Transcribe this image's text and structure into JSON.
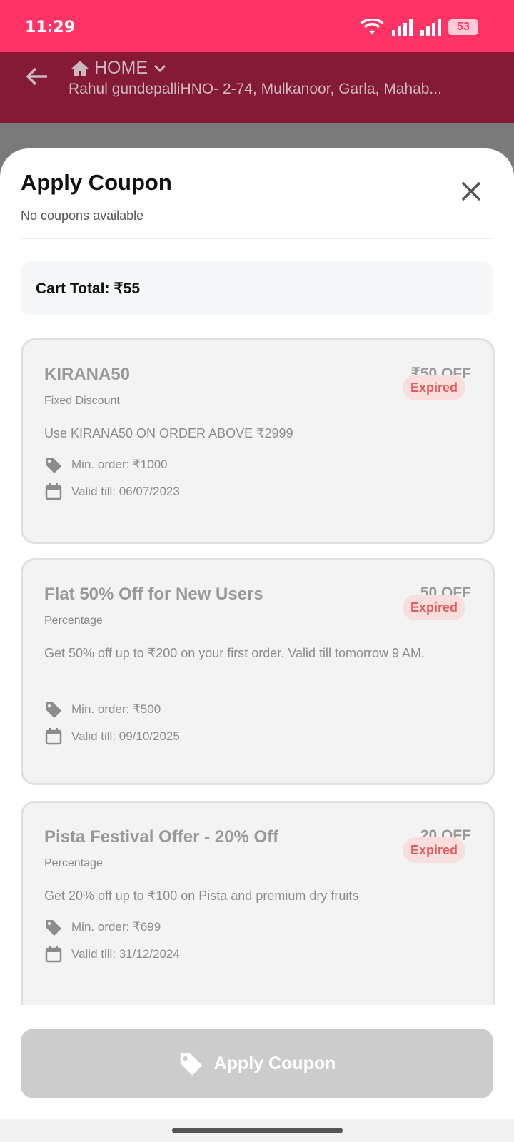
{
  "status": {
    "time": "11:29",
    "battery": "53"
  },
  "header": {
    "location_label": "HOME",
    "address": "Rahul gundepalliHNO- 2-74, Mulkanoor, Garla, Mahab..."
  },
  "sheet": {
    "title": "Apply Coupon",
    "subtitle": "No coupons available",
    "cart_total": "Cart Total: ₹55"
  },
  "coupons": [
    {
      "title": "KIRANA50",
      "type": "Fixed Discount",
      "off": "₹50 OFF",
      "status": "Expired",
      "desc": "Use KIRANA50 ON ORDER ABOVE ₹2999",
      "min_order": "Min. order: ₹1000",
      "valid": "Valid till: 06/07/2023"
    },
    {
      "title": "Flat 50% Off for New Users",
      "type": "Percentage",
      "off": "50 OFF",
      "status": "Expired",
      "desc": "Get 50% off up to ₹200 on your first order. Valid till tomorrow 9 AM.",
      "min_order": "Min. order: ₹500",
      "valid": "Valid till: 09/10/2025"
    },
    {
      "title": "Pista Festival Offer - 20% Off",
      "type": "Percentage",
      "off": "20 OFF",
      "status": "Expired",
      "desc": "Get 20% off up to ₹100 on Pista and premium dry fruits",
      "min_order": "Min. order: ₹699",
      "valid": "Valid till: 31/12/2024"
    }
  ],
  "apply_button": "Apply Coupon",
  "colors": {
    "status_bar": "#ff3366",
    "app_bar": "#851a37",
    "expired_text": "#e25c5c",
    "button_disabled": "#cccccc"
  },
  "icons": [
    "wifi-icon",
    "signal-icon",
    "back-arrow-icon",
    "home-icon",
    "chevron-down-icon",
    "close-icon",
    "tag-icon",
    "calendar-icon"
  ]
}
